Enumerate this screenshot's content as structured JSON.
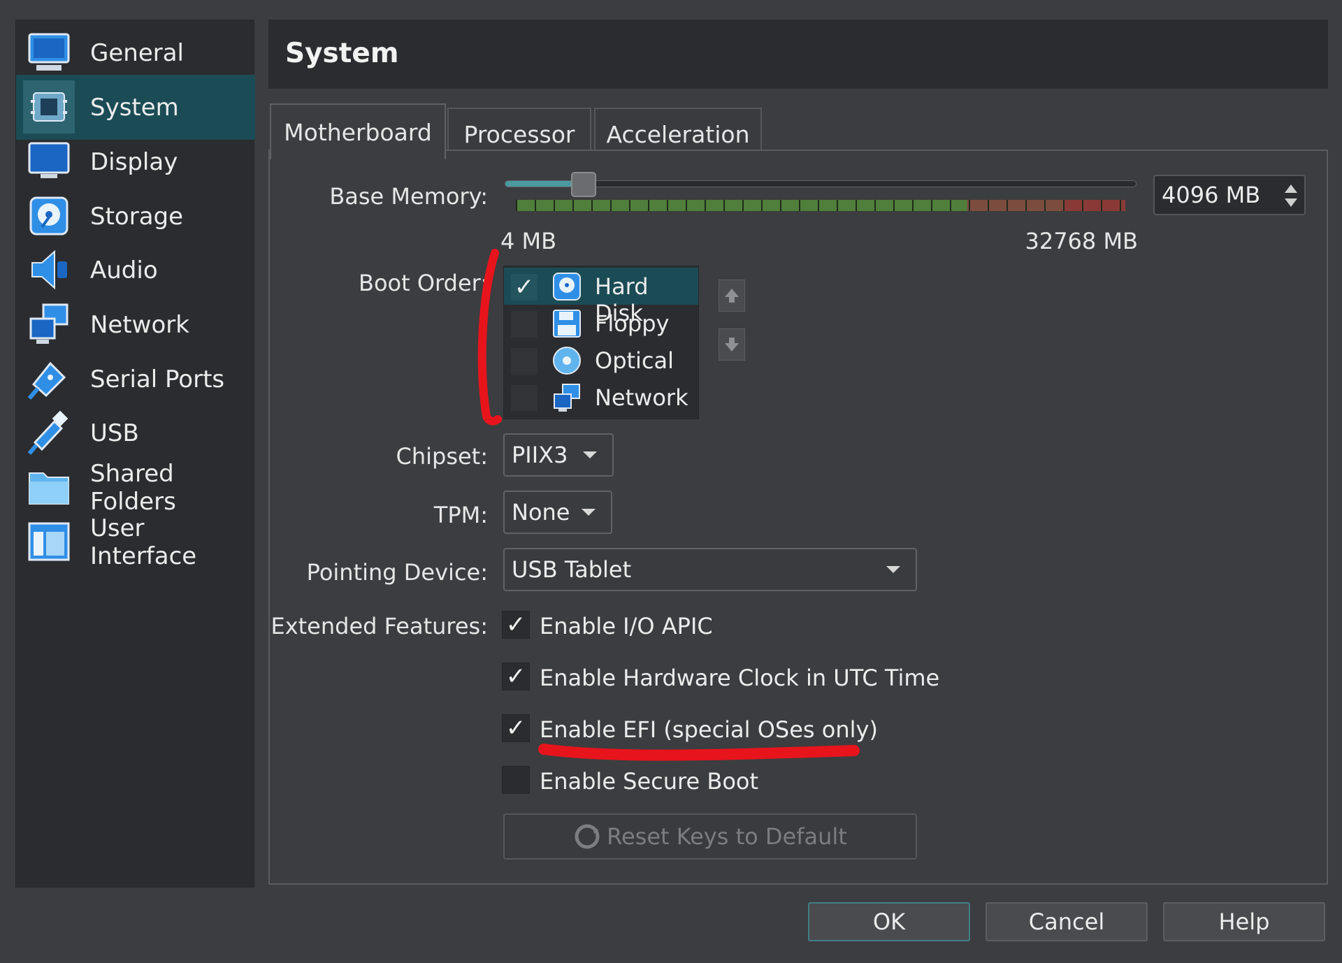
{
  "sidebar": {
    "items": [
      {
        "label": "General",
        "icon": "monitor-icon"
      },
      {
        "label": "System",
        "icon": "chip-icon",
        "selected": true
      },
      {
        "label": "Display",
        "icon": "display-icon"
      },
      {
        "label": "Storage",
        "icon": "storage-disk-icon"
      },
      {
        "label": "Audio",
        "icon": "speaker-icon"
      },
      {
        "label": "Network",
        "icon": "network-icon"
      },
      {
        "label": "Serial Ports",
        "icon": "serial-plug-icon"
      },
      {
        "label": "USB",
        "icon": "usb-icon"
      },
      {
        "label": "Shared Folders",
        "icon": "folder-icon"
      },
      {
        "label": "User Interface",
        "icon": "window-layout-icon"
      }
    ]
  },
  "header": {
    "title": "System"
  },
  "tabs": [
    {
      "label": "Motherboard",
      "active": true
    },
    {
      "label": "Processor",
      "active": false
    },
    {
      "label": "Acceleration",
      "active": false
    }
  ],
  "motherboard": {
    "base_memory": {
      "label": "Base Memory:",
      "value": "4096 MB",
      "min_label": "4 MB",
      "max_label": "32768 MB",
      "fraction": 0.125
    },
    "boot_order": {
      "label": "Boot Order:",
      "items": [
        {
          "label": "Hard Disk",
          "checked": true,
          "icon": "hard-disk-icon",
          "selected": true
        },
        {
          "label": "Floppy",
          "checked": false,
          "icon": "floppy-icon"
        },
        {
          "label": "Optical",
          "checked": false,
          "icon": "optical-disc-icon"
        },
        {
          "label": "Network",
          "checked": false,
          "icon": "network-icon"
        }
      ]
    },
    "chipset": {
      "label": "Chipset:",
      "value": "PIIX3"
    },
    "tpm": {
      "label": "TPM:",
      "value": "None"
    },
    "pointing_device": {
      "label": "Pointing Device:",
      "value": "USB Tablet"
    },
    "extended_features": {
      "label": "Extended Features:",
      "options": [
        {
          "label": "Enable I/O APIC",
          "checked": true
        },
        {
          "label": "Enable Hardware Clock in UTC Time",
          "checked": true
        },
        {
          "label": "Enable EFI (special OSes only)",
          "checked": true
        },
        {
          "label": "Enable Secure Boot",
          "checked": false
        }
      ]
    },
    "reset_keys_label": "Reset Keys to Default"
  },
  "buttons": {
    "ok": "OK",
    "cancel": "Cancel",
    "help": "Help"
  },
  "check_glyph": "✓",
  "colors": {
    "selection": "#1b4c55",
    "accent_icon": "#2f8fe6",
    "annotation": "#e8141c"
  }
}
